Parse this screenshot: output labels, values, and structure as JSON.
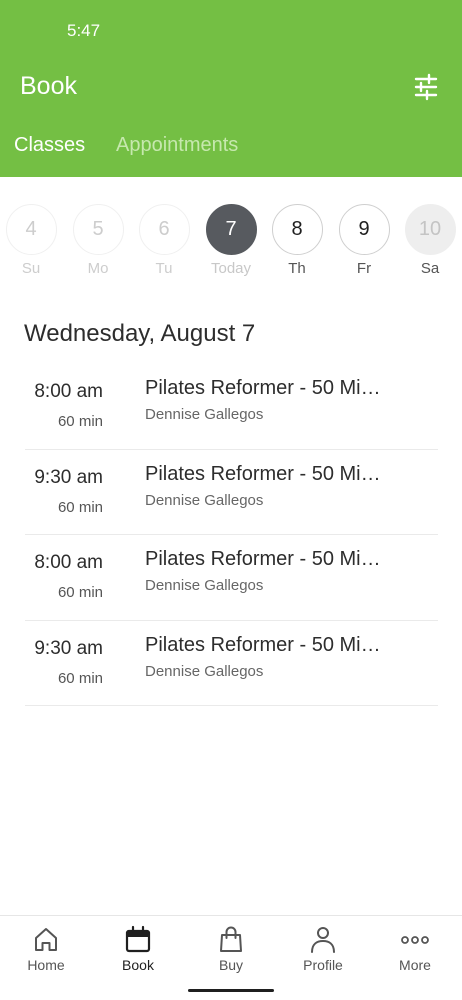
{
  "status_bar": {
    "time": "5:47"
  },
  "header": {
    "title": "Book",
    "background_color": "#74bf44",
    "filter_icon": "sliders-icon"
  },
  "tabs": [
    {
      "label": "Classes",
      "active": true
    },
    {
      "label": "Appointments",
      "active": false
    }
  ],
  "calendar": {
    "days": [
      {
        "number": "4",
        "label": "Su",
        "state": "past"
      },
      {
        "number": "5",
        "label": "Mo",
        "state": "past"
      },
      {
        "number": "6",
        "label": "Tu",
        "state": "past"
      },
      {
        "number": "7",
        "label": "Today",
        "state": "selected"
      },
      {
        "number": "8",
        "label": "Th",
        "state": "available"
      },
      {
        "number": "9",
        "label": "Fr",
        "state": "available"
      },
      {
        "number": "10",
        "label": "Sa",
        "state": "disabled"
      }
    ]
  },
  "date_heading": "Wednesday, August 7",
  "classes": [
    {
      "time": "8:00 am",
      "duration": "60 min",
      "name": "Pilates Reformer - 50 Min…",
      "instructor": "Dennise Gallegos"
    },
    {
      "time": "9:30 am",
      "duration": "60 min",
      "name": "Pilates Reformer - 50 Min…",
      "instructor": "Dennise Gallegos"
    },
    {
      "time": "8:00 am",
      "duration": "60 min",
      "name": "Pilates Reformer - 50 Min…",
      "instructor": "Dennise Gallegos"
    },
    {
      "time": "9:30 am",
      "duration": "60 min",
      "name": "Pilates Reformer - 50 Min…",
      "instructor": "Dennise Gallegos"
    }
  ],
  "bottom_nav": [
    {
      "label": "Home",
      "icon": "home-icon",
      "active": false
    },
    {
      "label": "Book",
      "icon": "calendar-icon",
      "active": true
    },
    {
      "label": "Buy",
      "icon": "shopping-bag-icon",
      "active": false
    },
    {
      "label": "Profile",
      "icon": "person-icon",
      "active": false
    },
    {
      "label": "More",
      "icon": "more-dots-icon",
      "active": false
    }
  ]
}
